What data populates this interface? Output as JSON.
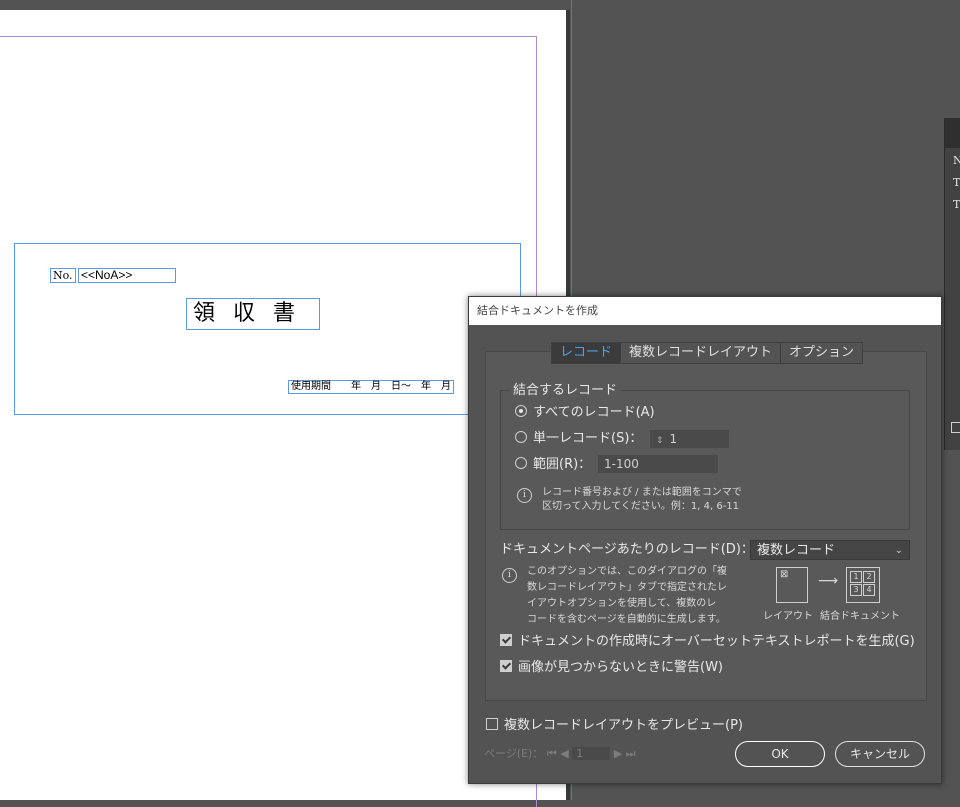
{
  "document": {
    "no_label": "No.",
    "no_field": "<<NoA>>",
    "title": "領収書",
    "period": "使用期間　　年　月　日～　年　月"
  },
  "side_panel": {
    "chars": [
      "N",
      "T",
      "T"
    ]
  },
  "dialog": {
    "title": "結合ドキュメントを作成",
    "tabs": [
      {
        "label": "レコード",
        "active": true
      },
      {
        "label": "複数レコードレイアウト",
        "active": false
      },
      {
        "label": "オプション",
        "active": false
      }
    ],
    "records_group": {
      "label": "結合するレコード",
      "all_records": "すべてのレコード(A)",
      "single_record": "単一レコード(S)：",
      "single_value": "1",
      "range": "範囲(R)：",
      "range_value": "1-100",
      "hint_line1": "レコード番号および / または範囲をコンマで",
      "hint_line2": "区切って入力してください。例：1, 4, 6-11"
    },
    "per_page": {
      "label": "ドキュメントページあたりのレコード(D)：",
      "value": "複数レコード",
      "desc_line1": "このオプションでは、このダイアログの「複",
      "desc_line2": "数レコードレイアウト」タブで指定されたレ",
      "desc_line3": "イアウトオプションを使用して、複数のレ",
      "desc_line4": "コードを含むページを自動的に生成します。",
      "diagram_layout_label": "レイアウト",
      "diagram_merged_label": "結合ドキュメント",
      "diagram_cells": [
        "1",
        "2",
        "3",
        "4"
      ]
    },
    "overset_report": {
      "label": "ドキュメントの作成時にオーバーセットテキストレポートを生成(G)",
      "checked": true
    },
    "missing_image_warning": {
      "label": "画像が見つからないときに警告(W)",
      "checked": true
    },
    "preview": {
      "label": "複数レコードレイアウトをプレビュー(P)",
      "checked": false
    },
    "page_nav": {
      "label": "ページ(E)：",
      "value": "1"
    },
    "ok_label": "OK",
    "cancel_label": "キャンセル"
  },
  "colors": {
    "accent_tab": "#4aa3f0",
    "frame_blue": "#5a9ae6",
    "bleed_line": "#d24a6a",
    "dialog_bg": "#535353"
  }
}
